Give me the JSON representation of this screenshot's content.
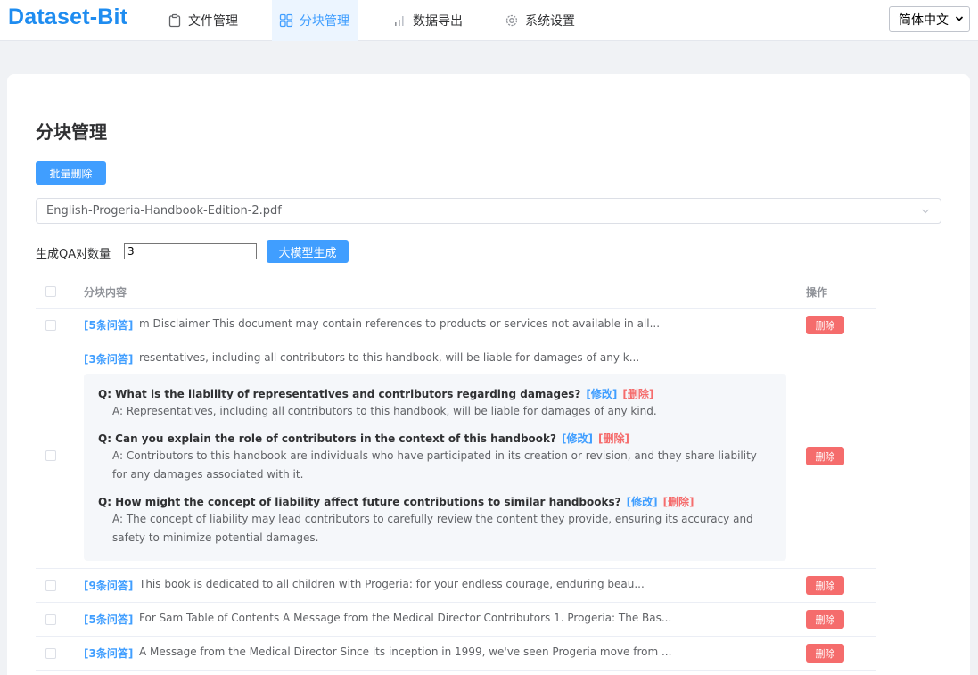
{
  "app": {
    "logo": "Dataset-Bit"
  },
  "nav": {
    "items": [
      {
        "label": "文件管理",
        "icon": "clipboard-icon",
        "active": false
      },
      {
        "label": "分块管理",
        "icon": "grid-icon",
        "active": true
      },
      {
        "label": "数据导出",
        "icon": "bar-chart-icon",
        "active": false
      },
      {
        "label": "系统设置",
        "icon": "gear-icon",
        "active": false
      }
    ],
    "language": "简体中文"
  },
  "page": {
    "title": "分块管理",
    "batch_delete_label": "批量删除",
    "file_selected": "English-Progeria-Handbook-Edition-2.pdf",
    "qa_count_label": "生成QA对数量",
    "qa_count_value": "3",
    "generate_label": "大模型生成"
  },
  "table": {
    "header_content": "分块内容",
    "header_action": "操作",
    "delete_label": "删除",
    "rows": [
      {
        "count": "[5条问答]",
        "text": "m Disclaimer This document may contain references to products or services not available in all..."
      },
      {
        "count": "[3条问答]",
        "text": "resentatives, including all contributors to this handbook, will be liable for damages of any k...",
        "qa": [
          {
            "q": "Q: What is the liability of representatives and contributors regarding damages?",
            "a": "A: Representatives, including all contributors to this handbook, will be liable for damages of any kind."
          },
          {
            "q": "Q: Can you explain the role of contributors in the context of this handbook?",
            "a": "A: Contributors to this handbook are individuals who have participated in its creation or revision, and they share liability for any damages associated with it."
          },
          {
            "q": "Q: How might the concept of liability affect future contributions to similar handbooks?",
            "a": "A: The concept of liability may lead contributors to carefully review the content they provide, ensuring its accuracy and safety to minimize potential damages."
          }
        ],
        "edit_label": "[修改]",
        "remove_label": "[删除]"
      },
      {
        "count": "[9条问答]",
        "text": "This book is dedicated to all children with Progeria: for your endless courage, enduring beau..."
      },
      {
        "count": "[5条问答]",
        "text": "For Sam Table of Contents A Message from the Medical Director Contributors 1. Progeria: The Bas..."
      },
      {
        "count": "[3条问答]",
        "text": "A Message from the Medical Director Since its inception in 1999, we've seen Progeria move from ..."
      }
    ]
  },
  "colors": {
    "primary": "#409eff",
    "danger": "#f56c6c",
    "logo": "#1e8cf0"
  }
}
